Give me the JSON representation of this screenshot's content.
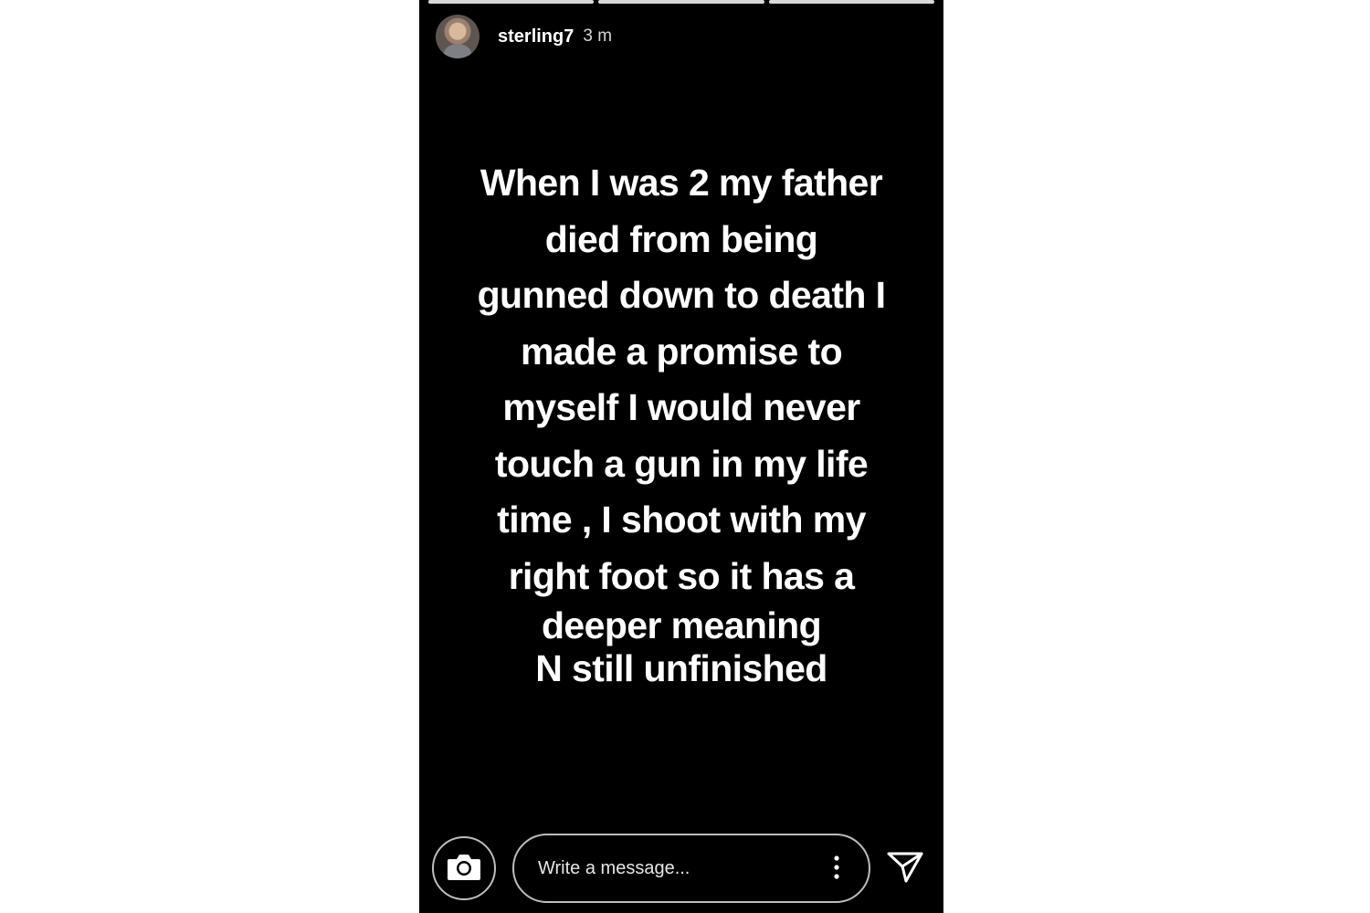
{
  "story": {
    "progress_segments": 3,
    "header": {
      "username": "sterling7",
      "time": "3 m"
    },
    "caption_lines": [
      "When I was 2 my father",
      "died from being",
      "gunned down to death I",
      "made a promise to",
      "myself I would never",
      "touch a gun in my life",
      "time , I shoot with my",
      "right foot so it has a",
      "deeper meaning",
      "N still unfinished"
    ],
    "footer": {
      "message_placeholder": "Write a message...",
      "camera_icon": "camera-icon",
      "more_icon": "more-vertical-icon",
      "send_icon": "send-icon"
    },
    "colors": {
      "background": "#000000",
      "text": "#ffffff",
      "border": "#bdbdbd"
    }
  }
}
